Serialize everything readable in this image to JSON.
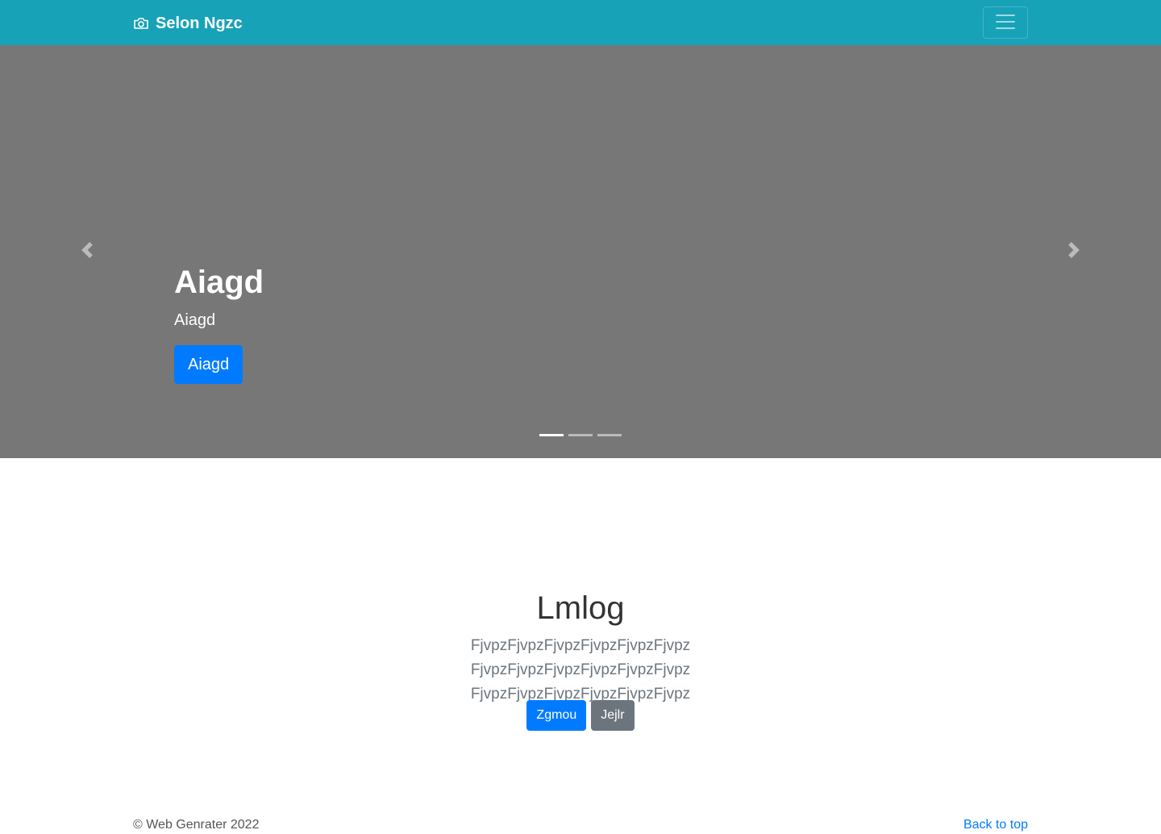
{
  "navbar": {
    "brand_name": "Selon Ngzc",
    "brand_icon": "camera-icon",
    "toggler_icon": "hamburger-menu-icon",
    "background": "#17a2b8"
  },
  "carousel": {
    "background": "#777777",
    "title": "Aiagd",
    "subtitle": "Aiagd",
    "button_label": "Aiagd",
    "prev_icon": "chevron-left-icon",
    "next_icon": "chevron-right-icon",
    "indicators": [
      {
        "active": true
      },
      {
        "active": false
      },
      {
        "active": false
      }
    ]
  },
  "section": {
    "title": "Lmlog",
    "lead": "FjvpzFjvpzFjvpzFjvpzFjvpzFjvpz FjvpzFjvpzFjvpzFjvpzFjvpzFjvpz FjvpzFjvpzFjvpzFjvpzFjvpzFjvpz",
    "primary_button": "Zgmou",
    "secondary_button": "Jejlr"
  },
  "footer": {
    "copyright": "© Web Genrater 2022",
    "back_to_top": "Back to top"
  },
  "colors": {
    "primary": "#007bff",
    "secondary": "#6c757d",
    "info": "#17a2b8"
  }
}
